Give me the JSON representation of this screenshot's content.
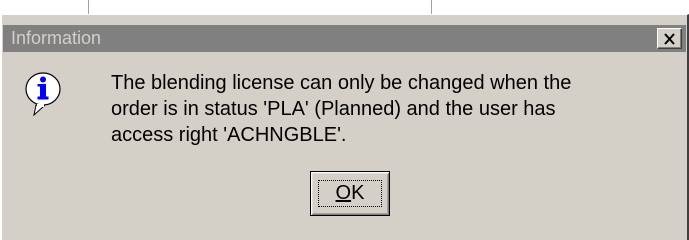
{
  "window": {
    "title": "Information",
    "close_symbol": "×"
  },
  "icon": {
    "name": "info-icon",
    "glyph": "i",
    "color": "#0000ff"
  },
  "message": {
    "lines": [
      "The blending license can only be changed when the",
      "order is in status 'PLA' (Planned) and the user has",
      "access right 'ACHNGBLE'."
    ]
  },
  "buttons": {
    "ok_mnemonic": "O",
    "ok_rest": "K"
  },
  "colors": {
    "titlebar_inactive": "#808080",
    "face": "#d4d0c8",
    "title_text": "#d4d0c8"
  }
}
